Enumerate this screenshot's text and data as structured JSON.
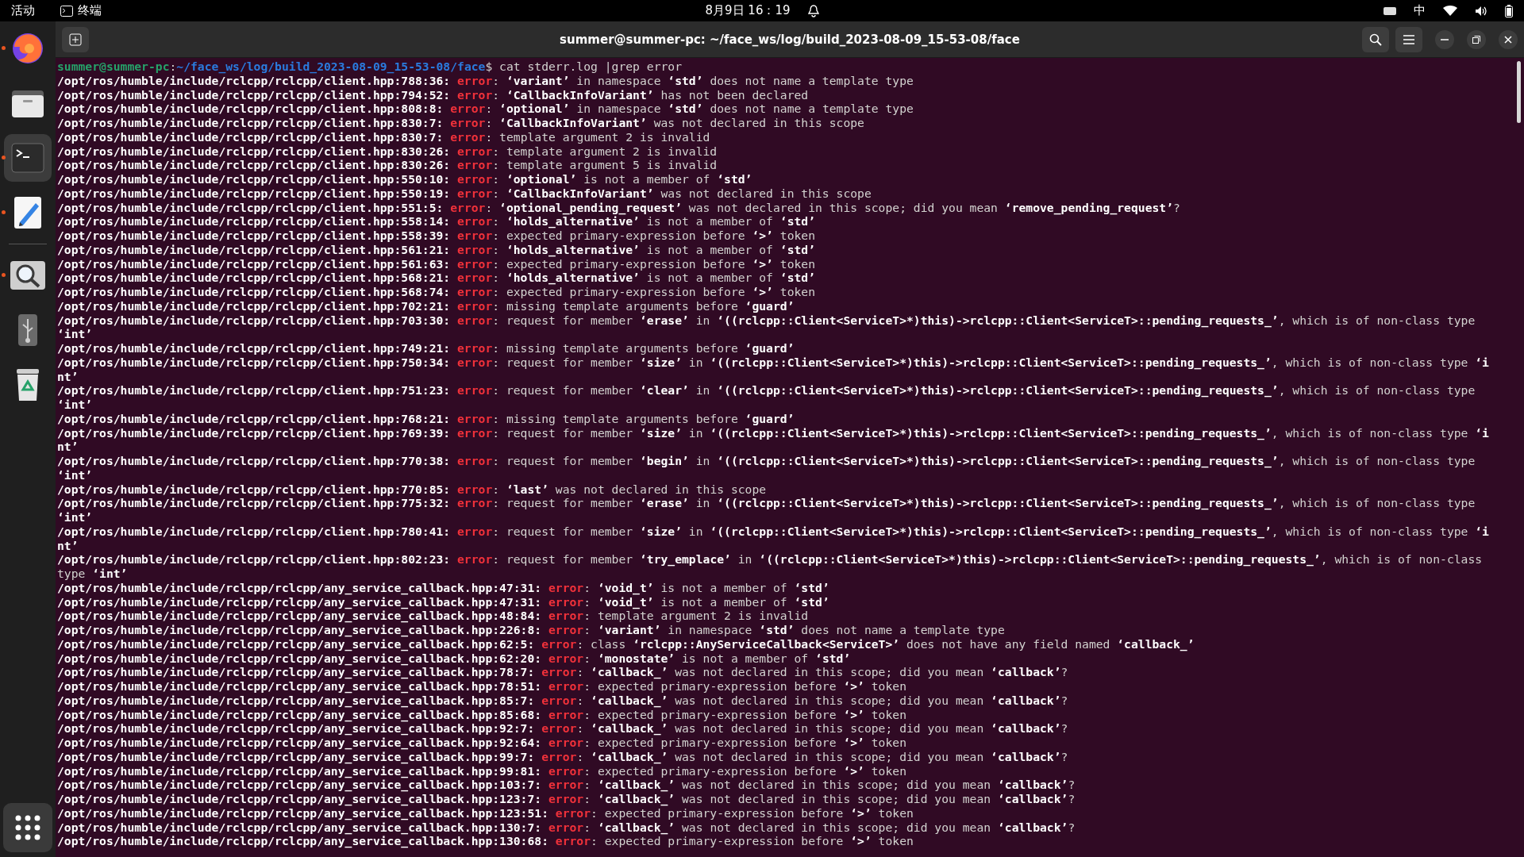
{
  "top_bar": {
    "activities": "活动",
    "app": "终端",
    "clock": "8月9日 16：19",
    "input_method": "中"
  },
  "dock": {
    "items": [
      {
        "kind": "browser",
        "running": true,
        "selected": false
      },
      {
        "kind": "files",
        "running": false,
        "selected": false
      },
      {
        "kind": "terminal",
        "running": true,
        "selected": true
      },
      {
        "kind": "editor",
        "running": true,
        "selected": false
      },
      {
        "kind": "divider"
      },
      {
        "kind": "search-tool",
        "running": true,
        "selected": false
      },
      {
        "kind": "usb",
        "running": false,
        "selected": false
      },
      {
        "kind": "trash",
        "running": false,
        "selected": false
      }
    ]
  },
  "window": {
    "title": "summer@summer-pc: ~/face_ws/log/build_2023-08-09_15-53-08/face"
  },
  "terminal": {
    "prompt": {
      "user_host": "summer@summer-pc",
      "separator": ":",
      "path": "~/face_ws/log/build_2023-08-09_15-53-08/face",
      "command": "$ cat stderr.log |grep error"
    },
    "lines": [
      {
        "location": "/opt/ros/humble/include/rclcpp/rclcpp/client.hpp:788:36:",
        "severity": "error",
        "parts": [
          {
            "text": ": ",
            "bold": false
          },
          {
            "text": "‘variant’",
            "bold": true
          },
          {
            "text": " in namespace ",
            "bold": false
          },
          {
            "text": "‘std’",
            "bold": true
          },
          {
            "text": " does not name a template type",
            "bold": false
          }
        ]
      },
      {
        "location": "/opt/ros/humble/include/rclcpp/rclcpp/client.hpp:794:52:",
        "severity": "error",
        "parts": [
          {
            "text": ": ",
            "bold": false
          },
          {
            "text": "‘CallbackInfoVariant’",
            "bold": true
          },
          {
            "text": " has not been declared",
            "bold": false
          }
        ]
      },
      {
        "location": "/opt/ros/humble/include/rclcpp/rclcpp/client.hpp:808:8:",
        "severity": "error",
        "parts": [
          {
            "text": ": ",
            "bold": false
          },
          {
            "text": "‘optional’",
            "bold": true
          },
          {
            "text": " in namespace ",
            "bold": false
          },
          {
            "text": "‘std’",
            "bold": true
          },
          {
            "text": " does not name a template type",
            "bold": false
          }
        ]
      },
      {
        "location": "/opt/ros/humble/include/rclcpp/rclcpp/client.hpp:830:7:",
        "severity": "error",
        "parts": [
          {
            "text": ": ",
            "bold": false
          },
          {
            "text": "‘CallbackInfoVariant’",
            "bold": true
          },
          {
            "text": " was not declared in this scope",
            "bold": false
          }
        ]
      },
      {
        "location": "/opt/ros/humble/include/rclcpp/rclcpp/client.hpp:830:7:",
        "severity": "error",
        "parts": [
          {
            "text": ": template argument 2 is invalid",
            "bold": false
          }
        ]
      },
      {
        "location": "/opt/ros/humble/include/rclcpp/rclcpp/client.hpp:830:26:",
        "severity": "error",
        "parts": [
          {
            "text": ": template argument 2 is invalid",
            "bold": false
          }
        ]
      },
      {
        "location": "/opt/ros/humble/include/rclcpp/rclcpp/client.hpp:830:26:",
        "severity": "error",
        "parts": [
          {
            "text": ": template argument 5 is invalid",
            "bold": false
          }
        ]
      },
      {
        "location": "/opt/ros/humble/include/rclcpp/rclcpp/client.hpp:550:10:",
        "severity": "error",
        "parts": [
          {
            "text": ": ",
            "bold": false
          },
          {
            "text": "‘optional’",
            "bold": true
          },
          {
            "text": " is not a member of ",
            "bold": false
          },
          {
            "text": "‘std’",
            "bold": true
          }
        ]
      },
      {
        "location": "/opt/ros/humble/include/rclcpp/rclcpp/client.hpp:550:19:",
        "severity": "error",
        "parts": [
          {
            "text": ": ",
            "bold": false
          },
          {
            "text": "‘CallbackInfoVariant’",
            "bold": true
          },
          {
            "text": " was not declared in this scope",
            "bold": false
          }
        ]
      },
      {
        "location": "/opt/ros/humble/include/rclcpp/rclcpp/client.hpp:551:5:",
        "severity": "error",
        "parts": [
          {
            "text": ": ",
            "bold": false
          },
          {
            "text": "‘optional_pending_request’",
            "bold": true
          },
          {
            "text": " was not declared in this scope; did you mean ",
            "bold": false
          },
          {
            "text": "‘remove_pending_request’",
            "bold": true
          },
          {
            "text": "?",
            "bold": false
          }
        ]
      },
      {
        "location": "/opt/ros/humble/include/rclcpp/rclcpp/client.hpp:558:14:",
        "severity": "error",
        "parts": [
          {
            "text": ": ",
            "bold": false
          },
          {
            "text": "‘holds_alternative’",
            "bold": true
          },
          {
            "text": " is not a member of ",
            "bold": false
          },
          {
            "text": "‘std’",
            "bold": true
          }
        ]
      },
      {
        "location": "/opt/ros/humble/include/rclcpp/rclcpp/client.hpp:558:39:",
        "severity": "error",
        "parts": [
          {
            "text": ": expected primary-expression before ",
            "bold": false
          },
          {
            "text": "‘>’",
            "bold": true
          },
          {
            "text": " token",
            "bold": false
          }
        ]
      },
      {
        "location": "/opt/ros/humble/include/rclcpp/rclcpp/client.hpp:561:21:",
        "severity": "error",
        "parts": [
          {
            "text": ": ",
            "bold": false
          },
          {
            "text": "‘holds_alternative’",
            "bold": true
          },
          {
            "text": " is not a member of ",
            "bold": false
          },
          {
            "text": "‘std’",
            "bold": true
          }
        ]
      },
      {
        "location": "/opt/ros/humble/include/rclcpp/rclcpp/client.hpp:561:63:",
        "severity": "error",
        "parts": [
          {
            "text": ": expected primary-expression before ",
            "bold": false
          },
          {
            "text": "‘>’",
            "bold": true
          },
          {
            "text": " token",
            "bold": false
          }
        ]
      },
      {
        "location": "/opt/ros/humble/include/rclcpp/rclcpp/client.hpp:568:21:",
        "severity": "error",
        "parts": [
          {
            "text": ": ",
            "bold": false
          },
          {
            "text": "‘holds_alternative’",
            "bold": true
          },
          {
            "text": " is not a member of ",
            "bold": false
          },
          {
            "text": "‘std’",
            "bold": true
          }
        ]
      },
      {
        "location": "/opt/ros/humble/include/rclcpp/rclcpp/client.hpp:568:74:",
        "severity": "error",
        "parts": [
          {
            "text": ": expected primary-expression before ",
            "bold": false
          },
          {
            "text": "‘>’",
            "bold": true
          },
          {
            "text": " token",
            "bold": false
          }
        ]
      },
      {
        "location": "/opt/ros/humble/include/rclcpp/rclcpp/client.hpp:702:21:",
        "severity": "error",
        "parts": [
          {
            "text": ": missing template arguments before ",
            "bold": false
          },
          {
            "text": "‘guard’",
            "bold": true
          }
        ]
      },
      {
        "location": "/opt/ros/humble/include/rclcpp/rclcpp/client.hpp:703:30:",
        "severity": "error",
        "parts": [
          {
            "text": ": request for member ",
            "bold": false
          },
          {
            "text": "‘erase’",
            "bold": true
          },
          {
            "text": " in ",
            "bold": false
          },
          {
            "text": "‘((rclcpp::Client<ServiceT>*)this)->rclcpp::Client<ServiceT>::pending_requests_’",
            "bold": true
          },
          {
            "text": ", which is of non-class type ",
            "bold": false
          },
          {
            "text": "‘int’",
            "bold": true
          }
        ]
      },
      {
        "location": "/opt/ros/humble/include/rclcpp/rclcpp/client.hpp:749:21:",
        "severity": "error",
        "parts": [
          {
            "text": ": missing template arguments before ",
            "bold": false
          },
          {
            "text": "‘guard’",
            "bold": true
          }
        ]
      },
      {
        "location": "/opt/ros/humble/include/rclcpp/rclcpp/client.hpp:750:34:",
        "severity": "error",
        "parts": [
          {
            "text": ": request for member ",
            "bold": false
          },
          {
            "text": "‘size’",
            "bold": true
          },
          {
            "text": " in ",
            "bold": false
          },
          {
            "text": "‘((rclcpp::Client<ServiceT>*)this)->rclcpp::Client<ServiceT>::pending_requests_’",
            "bold": true
          },
          {
            "text": ", which is of non-class type ",
            "bold": false
          },
          {
            "text": "‘int’",
            "bold": true
          }
        ]
      },
      {
        "location": "/opt/ros/humble/include/rclcpp/rclcpp/client.hpp:751:23:",
        "severity": "error",
        "parts": [
          {
            "text": ": request for member ",
            "bold": false
          },
          {
            "text": "‘clear’",
            "bold": true
          },
          {
            "text": " in ",
            "bold": false
          },
          {
            "text": "‘((rclcpp::Client<ServiceT>*)this)->rclcpp::Client<ServiceT>::pending_requests_’",
            "bold": true
          },
          {
            "text": ", which is of non-class type ",
            "bold": false
          },
          {
            "text": "‘int’",
            "bold": true
          }
        ]
      },
      {
        "location": "/opt/ros/humble/include/rclcpp/rclcpp/client.hpp:768:21:",
        "severity": "error",
        "parts": [
          {
            "text": ": missing template arguments before ",
            "bold": false
          },
          {
            "text": "‘guard’",
            "bold": true
          }
        ]
      },
      {
        "location": "/opt/ros/humble/include/rclcpp/rclcpp/client.hpp:769:39:",
        "severity": "error",
        "parts": [
          {
            "text": ": request for member ",
            "bold": false
          },
          {
            "text": "‘size’",
            "bold": true
          },
          {
            "text": " in ",
            "bold": false
          },
          {
            "text": "‘((rclcpp::Client<ServiceT>*)this)->rclcpp::Client<ServiceT>::pending_requests_’",
            "bold": true
          },
          {
            "text": ", which is of non-class type ",
            "bold": false
          },
          {
            "text": "‘int’",
            "bold": true
          }
        ]
      },
      {
        "location": "/opt/ros/humble/include/rclcpp/rclcpp/client.hpp:770:38:",
        "severity": "error",
        "parts": [
          {
            "text": ": request for member ",
            "bold": false
          },
          {
            "text": "‘begin’",
            "bold": true
          },
          {
            "text": " in ",
            "bold": false
          },
          {
            "text": "‘((rclcpp::Client<ServiceT>*)this)->rclcpp::Client<ServiceT>::pending_requests_’",
            "bold": true
          },
          {
            "text": ", which is of non-class type ",
            "bold": false
          },
          {
            "text": "‘int’",
            "bold": true
          }
        ]
      },
      {
        "location": "/opt/ros/humble/include/rclcpp/rclcpp/client.hpp:770:85:",
        "severity": "error",
        "parts": [
          {
            "text": ": ",
            "bold": false
          },
          {
            "text": "‘last’",
            "bold": true
          },
          {
            "text": " was not declared in this scope",
            "bold": false
          }
        ]
      },
      {
        "location": "/opt/ros/humble/include/rclcpp/rclcpp/client.hpp:775:32:",
        "severity": "error",
        "parts": [
          {
            "text": ": request for member ",
            "bold": false
          },
          {
            "text": "‘erase’",
            "bold": true
          },
          {
            "text": " in ",
            "bold": false
          },
          {
            "text": "‘((rclcpp::Client<ServiceT>*)this)->rclcpp::Client<ServiceT>::pending_requests_’",
            "bold": true
          },
          {
            "text": ", which is of non-class type ",
            "bold": false
          },
          {
            "text": "‘int’",
            "bold": true
          }
        ]
      },
      {
        "location": "/opt/ros/humble/include/rclcpp/rclcpp/client.hpp:780:41:",
        "severity": "error",
        "parts": [
          {
            "text": ": request for member ",
            "bold": false
          },
          {
            "text": "‘size’",
            "bold": true
          },
          {
            "text": " in ",
            "bold": false
          },
          {
            "text": "‘((rclcpp::Client<ServiceT>*)this)->rclcpp::Client<ServiceT>::pending_requests_’",
            "bold": true
          },
          {
            "text": ", which is of non-class type ",
            "bold": false
          },
          {
            "text": "‘int’",
            "bold": true
          }
        ]
      },
      {
        "location": "/opt/ros/humble/include/rclcpp/rclcpp/client.hpp:802:23:",
        "severity": "error",
        "parts": [
          {
            "text": ": request for member ",
            "bold": false
          },
          {
            "text": "‘try_emplace’",
            "bold": true
          },
          {
            "text": " in ",
            "bold": false
          },
          {
            "text": "‘((rclcpp::Client<ServiceT>*)this)->rclcpp::Client<ServiceT>::pending_requests_’",
            "bold": true
          },
          {
            "text": ", which is of non-class type ",
            "bold": false
          },
          {
            "text": "‘int’",
            "bold": true
          }
        ]
      },
      {
        "location": "/opt/ros/humble/include/rclcpp/rclcpp/any_service_callback.hpp:47:31:",
        "severity": "error",
        "parts": [
          {
            "text": ": ",
            "bold": false
          },
          {
            "text": "‘void_t’",
            "bold": true
          },
          {
            "text": " is not a member of ",
            "bold": false
          },
          {
            "text": "‘std’",
            "bold": true
          }
        ]
      },
      {
        "location": "/opt/ros/humble/include/rclcpp/rclcpp/any_service_callback.hpp:47:31:",
        "severity": "error",
        "parts": [
          {
            "text": ": ",
            "bold": false
          },
          {
            "text": "‘void_t’",
            "bold": true
          },
          {
            "text": " is not a member of ",
            "bold": false
          },
          {
            "text": "‘std’",
            "bold": true
          }
        ]
      },
      {
        "location": "/opt/ros/humble/include/rclcpp/rclcpp/any_service_callback.hpp:48:84:",
        "severity": "error",
        "parts": [
          {
            "text": ": template argument 2 is invalid",
            "bold": false
          }
        ]
      },
      {
        "location": "/opt/ros/humble/include/rclcpp/rclcpp/any_service_callback.hpp:226:8:",
        "severity": "error",
        "parts": [
          {
            "text": ": ",
            "bold": false
          },
          {
            "text": "‘variant’",
            "bold": true
          },
          {
            "text": " in namespace ",
            "bold": false
          },
          {
            "text": "‘std’",
            "bold": true
          },
          {
            "text": " does not name a template type",
            "bold": false
          }
        ]
      },
      {
        "location": "/opt/ros/humble/include/rclcpp/rclcpp/any_service_callback.hpp:62:5:",
        "severity": "error",
        "parts": [
          {
            "text": ": class ",
            "bold": false
          },
          {
            "text": "‘rclcpp::AnyServiceCallback<ServiceT>’",
            "bold": true
          },
          {
            "text": " does not have any field named ",
            "bold": false
          },
          {
            "text": "‘callback_’",
            "bold": true
          }
        ]
      },
      {
        "location": "/opt/ros/humble/include/rclcpp/rclcpp/any_service_callback.hpp:62:20:",
        "severity": "error",
        "parts": [
          {
            "text": ": ",
            "bold": false
          },
          {
            "text": "‘monostate’",
            "bold": true
          },
          {
            "text": " is not a member of ",
            "bold": false
          },
          {
            "text": "‘std’",
            "bold": true
          }
        ]
      },
      {
        "location": "/opt/ros/humble/include/rclcpp/rclcpp/any_service_callback.hpp:78:7:",
        "severity": "error",
        "parts": [
          {
            "text": ": ",
            "bold": false
          },
          {
            "text": "‘callback_’",
            "bold": true
          },
          {
            "text": " was not declared in this scope; did you mean ",
            "bold": false
          },
          {
            "text": "‘callback’",
            "bold": true
          },
          {
            "text": "?",
            "bold": false
          }
        ]
      },
      {
        "location": "/opt/ros/humble/include/rclcpp/rclcpp/any_service_callback.hpp:78:51:",
        "severity": "error",
        "parts": [
          {
            "text": ": expected primary-expression before ",
            "bold": false
          },
          {
            "text": "‘>’",
            "bold": true
          },
          {
            "text": " token",
            "bold": false
          }
        ]
      },
      {
        "location": "/opt/ros/humble/include/rclcpp/rclcpp/any_service_callback.hpp:85:7:",
        "severity": "error",
        "parts": [
          {
            "text": ": ",
            "bold": false
          },
          {
            "text": "‘callback_’",
            "bold": true
          },
          {
            "text": " was not declared in this scope; did you mean ",
            "bold": false
          },
          {
            "text": "‘callback’",
            "bold": true
          },
          {
            "text": "?",
            "bold": false
          }
        ]
      },
      {
        "location": "/opt/ros/humble/include/rclcpp/rclcpp/any_service_callback.hpp:85:68:",
        "severity": "error",
        "parts": [
          {
            "text": ": expected primary-expression before ",
            "bold": false
          },
          {
            "text": "‘>’",
            "bold": true
          },
          {
            "text": " token",
            "bold": false
          }
        ]
      },
      {
        "location": "/opt/ros/humble/include/rclcpp/rclcpp/any_service_callback.hpp:92:7:",
        "severity": "error",
        "parts": [
          {
            "text": ": ",
            "bold": false
          },
          {
            "text": "‘callback_’",
            "bold": true
          },
          {
            "text": " was not declared in this scope; did you mean ",
            "bold": false
          },
          {
            "text": "‘callback’",
            "bold": true
          },
          {
            "text": "?",
            "bold": false
          }
        ]
      },
      {
        "location": "/opt/ros/humble/include/rclcpp/rclcpp/any_service_callback.hpp:92:64:",
        "severity": "error",
        "parts": [
          {
            "text": ": expected primary-expression before ",
            "bold": false
          },
          {
            "text": "‘>’",
            "bold": true
          },
          {
            "text": " token",
            "bold": false
          }
        ]
      },
      {
        "location": "/opt/ros/humble/include/rclcpp/rclcpp/any_service_callback.hpp:99:7:",
        "severity": "error",
        "parts": [
          {
            "text": ": ",
            "bold": false
          },
          {
            "text": "‘callback_’",
            "bold": true
          },
          {
            "text": " was not declared in this scope; did you mean ",
            "bold": false
          },
          {
            "text": "‘callback’",
            "bold": true
          },
          {
            "text": "?",
            "bold": false
          }
        ]
      },
      {
        "location": "/opt/ros/humble/include/rclcpp/rclcpp/any_service_callback.hpp:99:81:",
        "severity": "error",
        "parts": [
          {
            "text": ": expected primary-expression before ",
            "bold": false
          },
          {
            "text": "‘>’",
            "bold": true
          },
          {
            "text": " token",
            "bold": false
          }
        ]
      },
      {
        "location": "/opt/ros/humble/include/rclcpp/rclcpp/any_service_callback.hpp:103:7:",
        "severity": "error",
        "parts": [
          {
            "text": ": ",
            "bold": false
          },
          {
            "text": "‘callback_’",
            "bold": true
          },
          {
            "text": " was not declared in this scope; did you mean ",
            "bold": false
          },
          {
            "text": "‘callback’",
            "bold": true
          },
          {
            "text": "?",
            "bold": false
          }
        ]
      },
      {
        "location": "/opt/ros/humble/include/rclcpp/rclcpp/any_service_callback.hpp:123:7:",
        "severity": "error",
        "parts": [
          {
            "text": ": ",
            "bold": false
          },
          {
            "text": "‘callback_’",
            "bold": true
          },
          {
            "text": " was not declared in this scope; did you mean ",
            "bold": false
          },
          {
            "text": "‘callback’",
            "bold": true
          },
          {
            "text": "?",
            "bold": false
          }
        ]
      },
      {
        "location": "/opt/ros/humble/include/rclcpp/rclcpp/any_service_callback.hpp:123:51:",
        "severity": "error",
        "parts": [
          {
            "text": ": expected primary-expression before ",
            "bold": false
          },
          {
            "text": "‘>’",
            "bold": true
          },
          {
            "text": " token",
            "bold": false
          }
        ]
      },
      {
        "location": "/opt/ros/humble/include/rclcpp/rclcpp/any_service_callback.hpp:130:7:",
        "severity": "error",
        "parts": [
          {
            "text": ": ",
            "bold": false
          },
          {
            "text": "‘callback_’",
            "bold": true
          },
          {
            "text": " was not declared in this scope; did you mean ",
            "bold": false
          },
          {
            "text": "‘callback’",
            "bold": true
          },
          {
            "text": "?",
            "bold": false
          }
        ]
      },
      {
        "location": "/opt/ros/humble/include/rclcpp/rclcpp/any_service_callback.hpp:130:68:",
        "severity": "error",
        "parts": [
          {
            "text": ": expected primary-expression before ",
            "bold": false
          },
          {
            "text": "‘>’",
            "bold": true
          },
          {
            "text": " token",
            "bold": false
          }
        ]
      }
    ]
  }
}
